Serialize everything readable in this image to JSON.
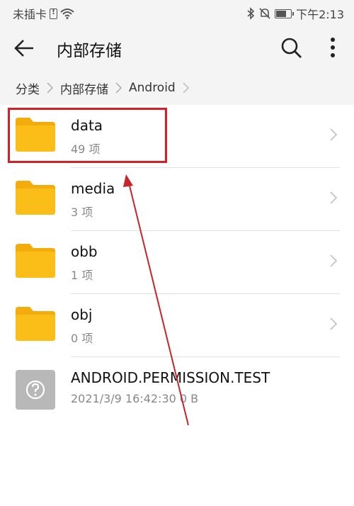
{
  "status_bar": {
    "carrier": "未插卡",
    "time": "下午2:13"
  },
  "toolbar": {
    "title": "内部存储",
    "back_icon": "back-arrow-icon",
    "search_icon": "search-icon",
    "more_icon": "more-vert-icon"
  },
  "breadcrumb": {
    "items": [
      "分类",
      "内部存储",
      "Android"
    ]
  },
  "files": [
    {
      "name": "data",
      "meta": "49 项",
      "type": "folder"
    },
    {
      "name": "media",
      "meta": "3 项",
      "type": "folder"
    },
    {
      "name": "obb",
      "meta": "1 项",
      "type": "folder"
    },
    {
      "name": "obj",
      "meta": "0 项",
      "type": "folder"
    },
    {
      "name": "ANDROID.PERMISSION.TEST",
      "meta": "2021/3/9 16:42:30  0 B",
      "type": "unknown"
    }
  ],
  "colors": {
    "folder": "#fbbd18",
    "folder_tab": "#f2ac0b",
    "highlight": "#d32027",
    "annotation_arrow": "#c8252b"
  }
}
